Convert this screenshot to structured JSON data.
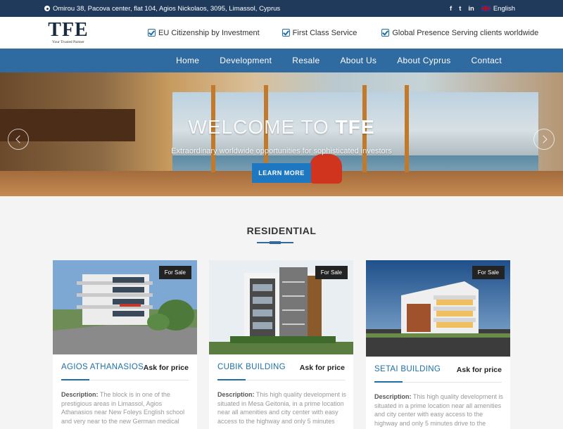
{
  "topbar": {
    "address": "Omirou 38, Pacova center, flat 104, Agios Nickolaos, 3095, Limassol, Cyprus",
    "social": [
      "f",
      "t",
      "in"
    ],
    "language": "English"
  },
  "header": {
    "logo_text": "TFE",
    "logo_tagline": "Your Trusted Partner",
    "features": [
      "EU Citizenship by Investment",
      "First Class Service",
      "Global Presence Serving clients worldwide"
    ]
  },
  "nav": [
    "Home",
    "Development",
    "Resale",
    "About Us",
    "About Cyprus",
    "Contact"
  ],
  "hero": {
    "title_light": "WELCOME TO ",
    "title_bold": "TFE",
    "subtitle": "Extraordinary worldwide opportunities for sophisticated investors",
    "cta": "LEARN MORE"
  },
  "section_title": "RESIDENTIAL",
  "properties": [
    {
      "badge": "For Sale",
      "name": "AGIOS ATHANASIOS",
      "price": "Ask for price",
      "desc_label": "Description:",
      "desc": "The block is in one of the prestigious areas in Limassol, Agios Athanasios near New Foleys English school and very near to the new German medical"
    },
    {
      "badge": "For Sale",
      "name": "CUBIK BUILDING",
      "price": "Ask for price",
      "desc_label": "Description:",
      "desc": "This high quality development is situated in Mesa Geitonia, in a prime location near all amenities and city center with easy access to the highway and only 5 minutes"
    },
    {
      "badge": "For Sale",
      "name": "SETAI BUILDING",
      "price": "Ask for price",
      "desc_label": "Description:",
      "desc": "This high quality development is situated in a prime location near all amenities and city center with easy access to the highway and only 5 minutes drive to the"
    }
  ]
}
